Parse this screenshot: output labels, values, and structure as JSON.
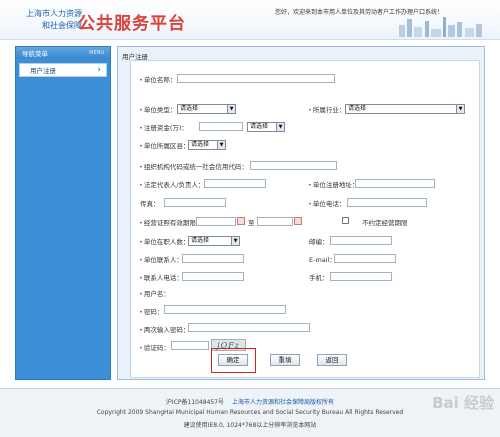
{
  "header": {
    "logo_line1": "上海市人力资源",
    "logo_line2": "和社会保障",
    "title": "公共服务平台",
    "welcome": "您好，欢迎来到本市用人单位及其劳动者户工作办理户口系统！"
  },
  "sidebar": {
    "heading": "导航菜单",
    "heading_en": "MENU",
    "items": [
      {
        "label": "用户注册"
      }
    ]
  },
  "panel": {
    "title": "用户注册"
  },
  "form": {
    "unit_name": "单位名称：",
    "unit_type": "单位类型：",
    "unit_type_value": "请选择",
    "industry": "所属行业：",
    "industry_value": "请选择",
    "capital": "注册资金(万)：",
    "capital_unit_value": "请选择",
    "region": "单位所属区县：",
    "region_value": "请选择",
    "org_code": "组织机构代码或统一社会信用代码：",
    "legal_rep": "法定代表人/负责人：",
    "reg_address": "单位注册地址：",
    "fax": "传真：",
    "phone": "单位电话：",
    "license_period": "经营证照有效期限：",
    "to": "至",
    "no_fixed_period": "不约定经营期限",
    "employees": "单位在职人数：",
    "employees_value": "请选择",
    "postcode": "邮编：",
    "contact": "单位联系人：",
    "email": "E-mail：",
    "contact_phone": "联系人电话：",
    "mobile": "手机：",
    "username": "用户名：",
    "password": "密码：",
    "password_again": "两次输入密码：",
    "captcha": "验证码：",
    "captcha_image": "jQFz"
  },
  "buttons": {
    "confirm": "确定",
    "reset": "重填",
    "back": "返回"
  },
  "footer": {
    "icp": "沪ICP备11048457号",
    "copyright_owner": "上海市人力资源和社会保障局版权所有",
    "copyright_en": "Copyright 2009 ShangHai Municipal Human Resources and Social Security Bureau All Rights Reserved",
    "advice": "建议使用IE8.0, 1024*768以上分辨率浏览本网站"
  },
  "watermark": "Bai 经验",
  "colors": {
    "accent": "#3c8fd6",
    "title_red": "#d9433a",
    "link_blue": "#1b56a8",
    "highlight": "#d9261c"
  }
}
